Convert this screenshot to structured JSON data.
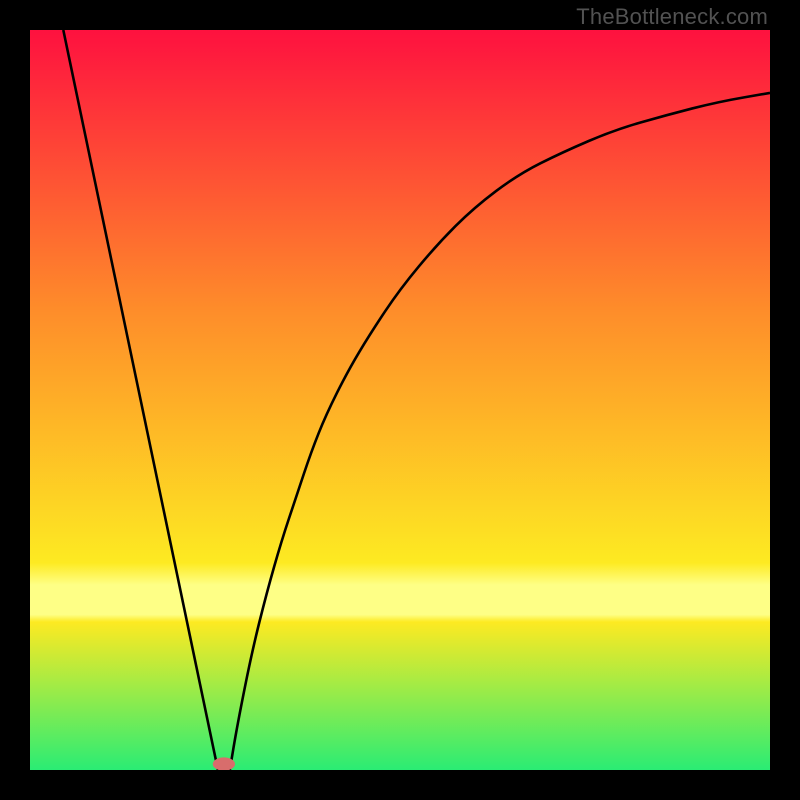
{
  "watermark": "TheBottleneck.com",
  "colors": {
    "frame": "#000000",
    "gradient_top": "#fe113f",
    "gradient_mid1": "#fe8d2a",
    "gradient_mid2": "#fdea22",
    "gradient_band": "#feff86",
    "gradient_bottom": "#2aec74",
    "curve": "#000000",
    "marker": "#d86d6c"
  },
  "chart_data": {
    "type": "line",
    "title": "",
    "xlabel": "",
    "ylabel": "",
    "xlim": [
      0,
      100
    ],
    "ylim": [
      0,
      100
    ],
    "left_segment": {
      "x": [
        4.5,
        25.4
      ],
      "y": [
        100,
        0
      ]
    },
    "right_curve": {
      "x": [
        27.0,
        28,
        30,
        32,
        34,
        36,
        38,
        40,
        43,
        46,
        50,
        55,
        60,
        66,
        72,
        79,
        86,
        93,
        100
      ],
      "y": [
        0,
        6,
        16,
        24,
        31,
        37,
        43,
        48,
        54,
        59,
        65,
        71,
        76,
        80.5,
        83.5,
        86.5,
        88.5,
        90.3,
        91.5
      ]
    },
    "marker": {
      "x_center": 26.2,
      "y": 0.8,
      "rx": 1.5,
      "ry": 0.9
    },
    "yellow_band_y": [
      21,
      25
    ]
  }
}
